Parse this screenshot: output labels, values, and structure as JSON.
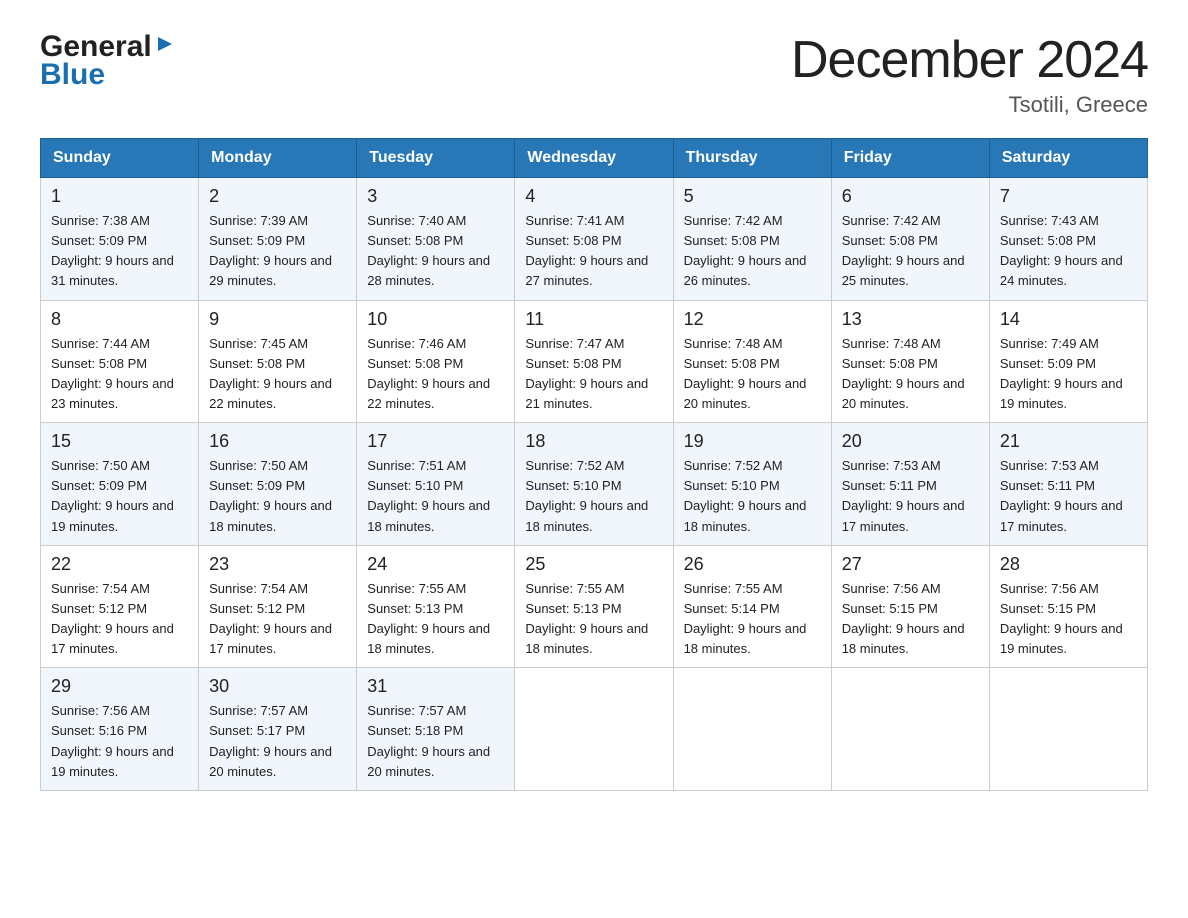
{
  "logo": {
    "general": "General",
    "blue": "Blue"
  },
  "header": {
    "month_year": "December 2024",
    "location": "Tsotili, Greece"
  },
  "days_of_week": [
    "Sunday",
    "Monday",
    "Tuesday",
    "Wednesday",
    "Thursday",
    "Friday",
    "Saturday"
  ],
  "weeks": [
    [
      {
        "num": "1",
        "sunrise": "7:38 AM",
        "sunset": "5:09 PM",
        "daylight": "9 hours and 31 minutes."
      },
      {
        "num": "2",
        "sunrise": "7:39 AM",
        "sunset": "5:09 PM",
        "daylight": "9 hours and 29 minutes."
      },
      {
        "num": "3",
        "sunrise": "7:40 AM",
        "sunset": "5:08 PM",
        "daylight": "9 hours and 28 minutes."
      },
      {
        "num": "4",
        "sunrise": "7:41 AM",
        "sunset": "5:08 PM",
        "daylight": "9 hours and 27 minutes."
      },
      {
        "num": "5",
        "sunrise": "7:42 AM",
        "sunset": "5:08 PM",
        "daylight": "9 hours and 26 minutes."
      },
      {
        "num": "6",
        "sunrise": "7:42 AM",
        "sunset": "5:08 PM",
        "daylight": "9 hours and 25 minutes."
      },
      {
        "num": "7",
        "sunrise": "7:43 AM",
        "sunset": "5:08 PM",
        "daylight": "9 hours and 24 minutes."
      }
    ],
    [
      {
        "num": "8",
        "sunrise": "7:44 AM",
        "sunset": "5:08 PM",
        "daylight": "9 hours and 23 minutes."
      },
      {
        "num": "9",
        "sunrise": "7:45 AM",
        "sunset": "5:08 PM",
        "daylight": "9 hours and 22 minutes."
      },
      {
        "num": "10",
        "sunrise": "7:46 AM",
        "sunset": "5:08 PM",
        "daylight": "9 hours and 22 minutes."
      },
      {
        "num": "11",
        "sunrise": "7:47 AM",
        "sunset": "5:08 PM",
        "daylight": "9 hours and 21 minutes."
      },
      {
        "num": "12",
        "sunrise": "7:48 AM",
        "sunset": "5:08 PM",
        "daylight": "9 hours and 20 minutes."
      },
      {
        "num": "13",
        "sunrise": "7:48 AM",
        "sunset": "5:08 PM",
        "daylight": "9 hours and 20 minutes."
      },
      {
        "num": "14",
        "sunrise": "7:49 AM",
        "sunset": "5:09 PM",
        "daylight": "9 hours and 19 minutes."
      }
    ],
    [
      {
        "num": "15",
        "sunrise": "7:50 AM",
        "sunset": "5:09 PM",
        "daylight": "9 hours and 19 minutes."
      },
      {
        "num": "16",
        "sunrise": "7:50 AM",
        "sunset": "5:09 PM",
        "daylight": "9 hours and 18 minutes."
      },
      {
        "num": "17",
        "sunrise": "7:51 AM",
        "sunset": "5:10 PM",
        "daylight": "9 hours and 18 minutes."
      },
      {
        "num": "18",
        "sunrise": "7:52 AM",
        "sunset": "5:10 PM",
        "daylight": "9 hours and 18 minutes."
      },
      {
        "num": "19",
        "sunrise": "7:52 AM",
        "sunset": "5:10 PM",
        "daylight": "9 hours and 18 minutes."
      },
      {
        "num": "20",
        "sunrise": "7:53 AM",
        "sunset": "5:11 PM",
        "daylight": "9 hours and 17 minutes."
      },
      {
        "num": "21",
        "sunrise": "7:53 AM",
        "sunset": "5:11 PM",
        "daylight": "9 hours and 17 minutes."
      }
    ],
    [
      {
        "num": "22",
        "sunrise": "7:54 AM",
        "sunset": "5:12 PM",
        "daylight": "9 hours and 17 minutes."
      },
      {
        "num": "23",
        "sunrise": "7:54 AM",
        "sunset": "5:12 PM",
        "daylight": "9 hours and 17 minutes."
      },
      {
        "num": "24",
        "sunrise": "7:55 AM",
        "sunset": "5:13 PM",
        "daylight": "9 hours and 18 minutes."
      },
      {
        "num": "25",
        "sunrise": "7:55 AM",
        "sunset": "5:13 PM",
        "daylight": "9 hours and 18 minutes."
      },
      {
        "num": "26",
        "sunrise": "7:55 AM",
        "sunset": "5:14 PM",
        "daylight": "9 hours and 18 minutes."
      },
      {
        "num": "27",
        "sunrise": "7:56 AM",
        "sunset": "5:15 PM",
        "daylight": "9 hours and 18 minutes."
      },
      {
        "num": "28",
        "sunrise": "7:56 AM",
        "sunset": "5:15 PM",
        "daylight": "9 hours and 19 minutes."
      }
    ],
    [
      {
        "num": "29",
        "sunrise": "7:56 AM",
        "sunset": "5:16 PM",
        "daylight": "9 hours and 19 minutes."
      },
      {
        "num": "30",
        "sunrise": "7:57 AM",
        "sunset": "5:17 PM",
        "daylight": "9 hours and 20 minutes."
      },
      {
        "num": "31",
        "sunrise": "7:57 AM",
        "sunset": "5:18 PM",
        "daylight": "9 hours and 20 minutes."
      },
      null,
      null,
      null,
      null
    ]
  ]
}
